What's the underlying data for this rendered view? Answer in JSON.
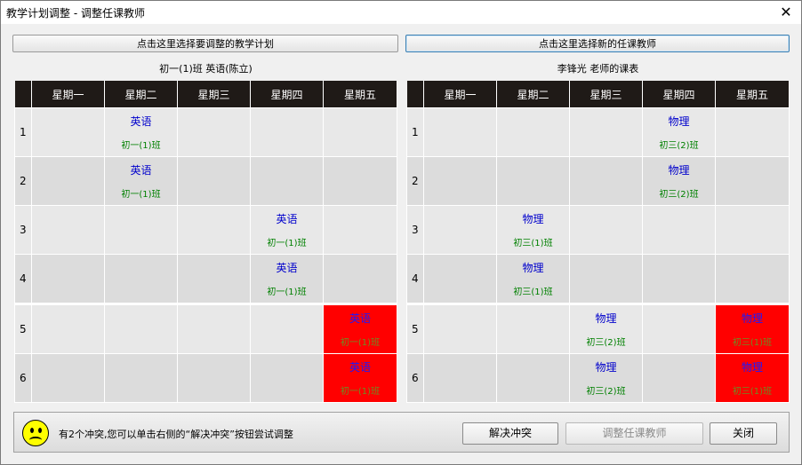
{
  "window": {
    "title": "教学计划调整 - 调整任课教师",
    "close_glyph": "✕"
  },
  "toolbar": {
    "select_plan_label": "点击这里选择要调整的教学计划",
    "select_teacher_label": "点击这里选择新的任课教师"
  },
  "weekdays": [
    "星期一",
    "星期二",
    "星期三",
    "星期四",
    "星期五"
  ],
  "left_table": {
    "caption": "初一(1)班 英语(陈立)",
    "rows": [
      {
        "num": "1",
        "cells": [
          null,
          {
            "subject": "英语",
            "class": "初一(1)班"
          },
          null,
          null,
          null
        ]
      },
      {
        "num": "2",
        "cells": [
          null,
          {
            "subject": "英语",
            "class": "初一(1)班"
          },
          null,
          null,
          null
        ]
      },
      {
        "num": "3",
        "cells": [
          null,
          null,
          null,
          {
            "subject": "英语",
            "class": "初一(1)班"
          },
          null
        ]
      },
      {
        "num": "4",
        "cells": [
          null,
          null,
          null,
          {
            "subject": "英语",
            "class": "初一(1)班"
          },
          null
        ]
      },
      {
        "num": "5",
        "cells": [
          null,
          null,
          null,
          null,
          {
            "subject": "英语",
            "class": "初一(1)班",
            "conflict": true
          }
        ]
      },
      {
        "num": "6",
        "cells": [
          null,
          null,
          null,
          null,
          {
            "subject": "英语",
            "class": "初一(1)班",
            "conflict": true
          }
        ]
      }
    ]
  },
  "right_table": {
    "caption": "李锋光 老师的课表",
    "rows": [
      {
        "num": "1",
        "cells": [
          null,
          null,
          null,
          {
            "subject": "物理",
            "class": "初三(2)班"
          },
          null
        ]
      },
      {
        "num": "2",
        "cells": [
          null,
          null,
          null,
          {
            "subject": "物理",
            "class": "初三(2)班"
          },
          null
        ]
      },
      {
        "num": "3",
        "cells": [
          null,
          {
            "subject": "物理",
            "class": "初三(1)班"
          },
          null,
          null,
          null
        ]
      },
      {
        "num": "4",
        "cells": [
          null,
          {
            "subject": "物理",
            "class": "初三(1)班"
          },
          null,
          null,
          null
        ]
      },
      {
        "num": "5",
        "cells": [
          null,
          null,
          {
            "subject": "物理",
            "class": "初三(2)班"
          },
          null,
          {
            "subject": "物理",
            "class": "初三(1)班",
            "conflict": true
          }
        ]
      },
      {
        "num": "6",
        "cells": [
          null,
          null,
          {
            "subject": "物理",
            "class": "初三(2)班"
          },
          null,
          {
            "subject": "物理",
            "class": "初三(1)班",
            "conflict": true
          }
        ]
      }
    ]
  },
  "status": {
    "icon": "sad-face-icon",
    "message": "有2个冲突,您可以单击右侧的“解决冲突”按钮尝试调整",
    "resolve_label": "解决冲突",
    "adjust_label": "调整任课教师",
    "close_label": "关闭"
  },
  "colors": {
    "header_bg": "#1f1a17",
    "conflict": "#ff0000",
    "subject_text": "#0000cc",
    "class_text": "#008000",
    "face": "#ffff00"
  }
}
